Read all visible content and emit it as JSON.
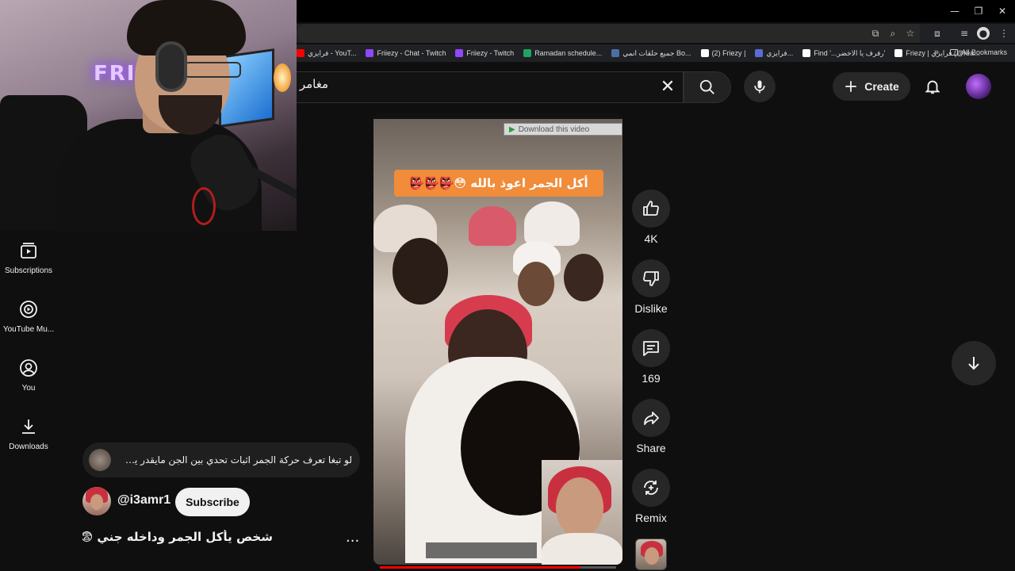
{
  "browser": {
    "bookmarks": [
      {
        "label": "فرايزي - YouT...",
        "color": "#ff0000"
      },
      {
        "label": "Friiezy - Chat - Twitch",
        "color": "#9146ff"
      },
      {
        "label": "Friiezy - Twitch",
        "color": "#9146ff"
      },
      {
        "label": "Ramadan schedule...",
        "color": "#1fa463"
      },
      {
        "label": "جميع حلقات انمي Bo...",
        "color": "#4a6fa5"
      },
      {
        "label": "(2) Friezy |",
        "color": "#ffffff"
      },
      {
        "label": "فرايزي...",
        "color": "#5b6bd6"
      },
      {
        "label": "Find '...رفرف يا الاخضر'",
        "color": "#ffffff"
      },
      {
        "label": "Friezy | فرايزي (@rea...",
        "color": "#ffffff"
      }
    ],
    "overflow": "»",
    "all_bookmarks": "All Bookmarks"
  },
  "webcam": {
    "neon_sign": "FRIE"
  },
  "topbar": {
    "search_value": "مغامر",
    "create_label": "Create"
  },
  "nav": [
    {
      "label": "Subscriptions",
      "icon": "subscriptions-icon"
    },
    {
      "label": "YouTube Mu...",
      "icon": "youtube-music-icon"
    },
    {
      "label": "You",
      "icon": "you-icon"
    },
    {
      "label": "Downloads",
      "icon": "downloads-icon"
    }
  ],
  "short": {
    "download_bar": "Download this video",
    "caption": "أكل الجمر اعوذ بالله 😳👺👺👺",
    "progress": 0.85
  },
  "actions": {
    "like_count": "4K",
    "dislike_label": "Dislike",
    "comment_count": "169",
    "share_label": "Share",
    "remix_label": "Remix"
  },
  "meta": {
    "comment_preview": "لو تبغا تعرف حركة الجمر اثبات تحدي بين الجن  مايقدر يسوي ذا...",
    "channel": "@i3amr1",
    "subscribe_label": "Subscribe",
    "title": "شخص يأكل الجمر وداخله جني 😨",
    "more": "..."
  }
}
